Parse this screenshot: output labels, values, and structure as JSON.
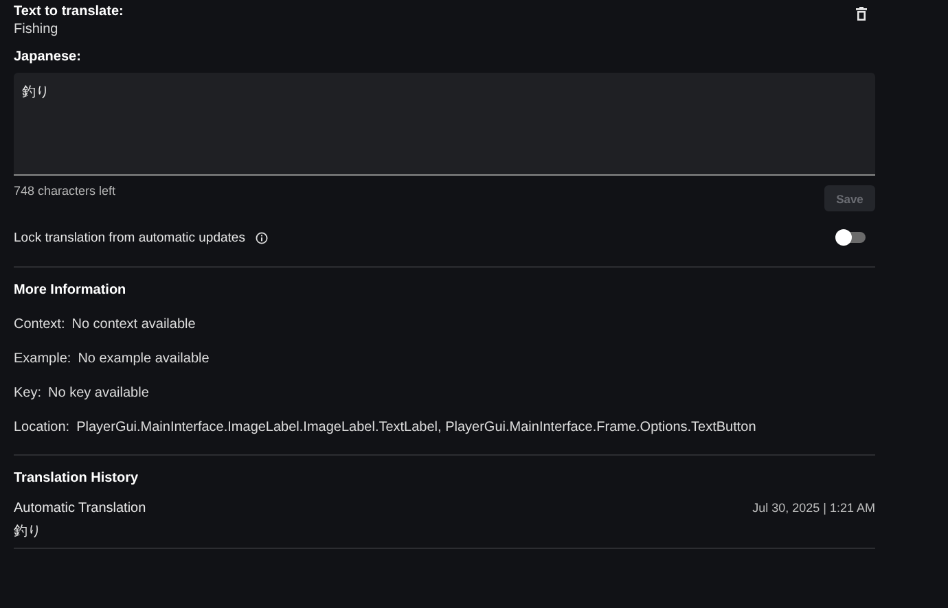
{
  "source": {
    "label": "Text to translate:",
    "text": "Fishing"
  },
  "translation": {
    "label": "Japanese:",
    "value": "釣り",
    "counter": "748 characters left"
  },
  "save_button": {
    "label": "Save",
    "disabled": true
  },
  "lock": {
    "label": "Lock translation from automatic updates",
    "on": false
  },
  "more_information": {
    "title": "More Information",
    "rows": [
      {
        "label": "Context:",
        "value": "No context available"
      },
      {
        "label": "Example:",
        "value": "No example available"
      },
      {
        "label": "Key:",
        "value": "No key available"
      },
      {
        "label": "Location:",
        "value": "PlayerGui.MainInterface.ImageLabel.ImageLabel.TextLabel, PlayerGui.MainInterface.Frame.Options.TextButton"
      }
    ]
  },
  "translation_history": {
    "title": "Translation History",
    "entries": [
      {
        "source": "Automatic Translation",
        "date": "Jul 30, 2025 | 1:21 AM",
        "text": "釣り"
      }
    ]
  }
}
